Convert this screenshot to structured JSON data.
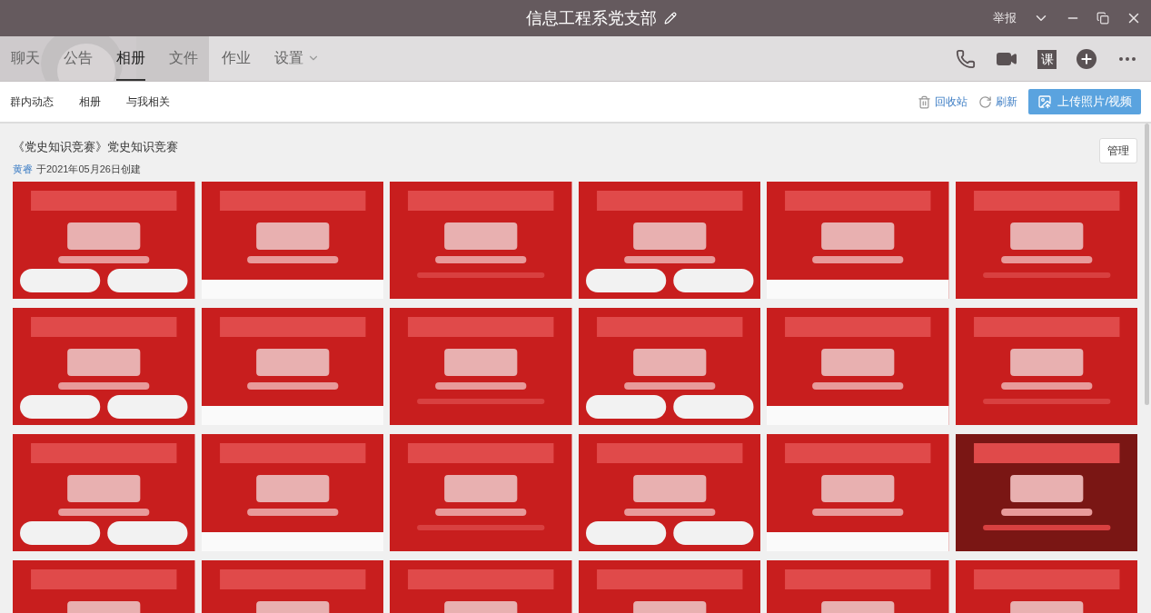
{
  "window": {
    "title": "信息工程系党支部",
    "report": "举报"
  },
  "tabs": [
    {
      "label": "聊天",
      "selected": false
    },
    {
      "label": "公告",
      "selected": false
    },
    {
      "label": "相册",
      "selected": true
    },
    {
      "label": "文件",
      "selected": false
    },
    {
      "label": "作业",
      "selected": false
    },
    {
      "label": "设置",
      "selected": false,
      "dropdown": true
    }
  ],
  "toolbar": {
    "course_label": "课"
  },
  "subnav": [
    {
      "label": "群内动态"
    },
    {
      "label": "相册"
    },
    {
      "label": "与我相关"
    }
  ],
  "actions": {
    "recycle": "回收站",
    "refresh": "刷新",
    "upload": "上传照片/视频"
  },
  "album": {
    "title": "《党史知识竞赛》党史知识竞赛",
    "author": "黄睿",
    "created": "于2021年05月26日创建",
    "manage": "管理"
  }
}
